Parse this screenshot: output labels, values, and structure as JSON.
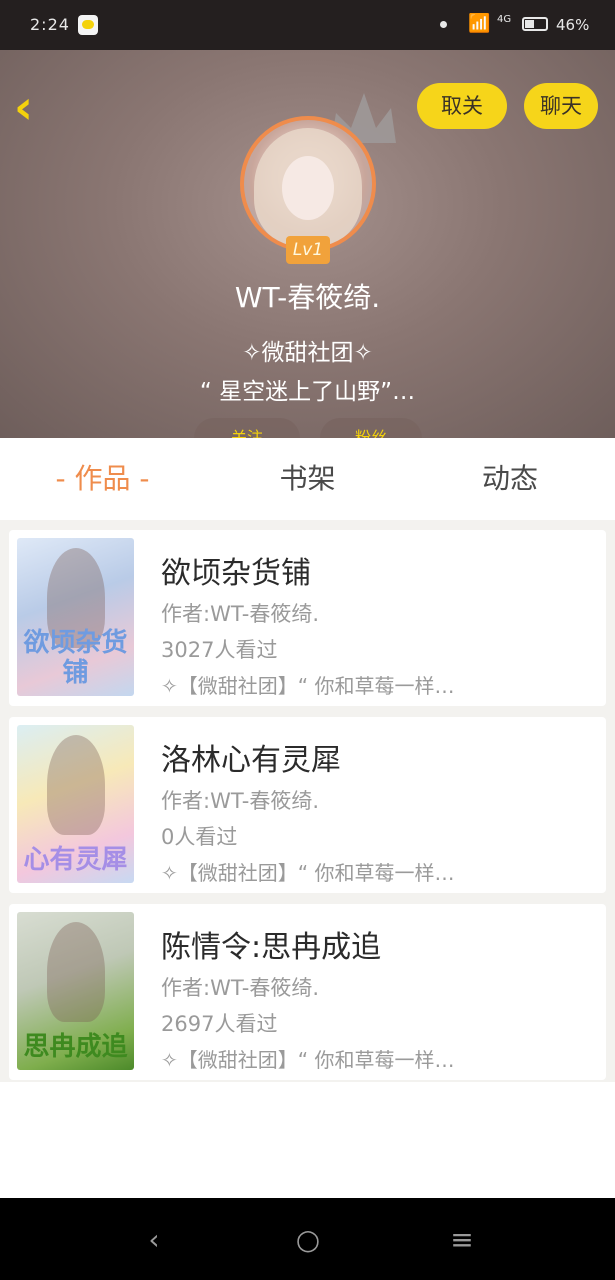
{
  "status_bar": {
    "time": "2:24",
    "network": "4G",
    "battery": "46%",
    "battery_level": 0.46
  },
  "header": {
    "unfollow_label": "取关",
    "chat_label": "聊天",
    "level": "Lv1",
    "username": "WT-春筱绮.",
    "club": "✧微甜社团✧",
    "bio": "“ 星空迷上了山野”…",
    "following_label": "关注",
    "fans_label": "粉丝"
  },
  "tabs": [
    {
      "label": "- 作品 -",
      "active": true
    },
    {
      "label": "书架",
      "active": false
    },
    {
      "label": "动态",
      "active": false
    }
  ],
  "works": [
    {
      "title": "欲顷杂货铺",
      "author": "作者:WT-春筱绮.",
      "views": "3027人看过",
      "desc": "✧【微甜社团】“ 你和草莓一样…",
      "cover_text": "欲顷杂货铺"
    },
    {
      "title": "洛林心有灵犀",
      "author": "作者:WT-春筱绮.",
      "views": "0人看过",
      "desc": "✧【微甜社团】“ 你和草莓一样…",
      "cover_text": "心有灵犀"
    },
    {
      "title": "陈情令:思冉成追",
      "author": "作者:WT-春筱绮.",
      "views": "2697人看过",
      "desc": "✧【微甜社团】“ 你和草莓一样…",
      "cover_text": "思冉成追"
    }
  ],
  "nav": {
    "back_icon": "‹",
    "home_icon": "○",
    "menu_icon": "≡"
  },
  "colors": {
    "accent_yellow": "#f6d51a",
    "accent_orange": "#ef8c4c"
  }
}
